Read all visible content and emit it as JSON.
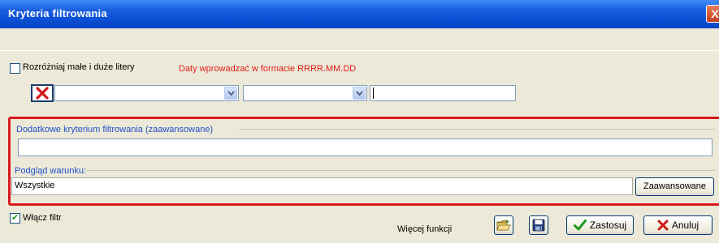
{
  "window": {
    "title": "Kryteria filtrowania",
    "close_glyph": "X"
  },
  "options": {
    "case_sensitive_label": "Rozróżniaj małe i duże litery",
    "case_sensitive_checked": false,
    "date_hint": "Daty wprowadzać w formacie RRRR.MM.DD"
  },
  "criteria_row": {
    "remove_icon": "red-x-icon",
    "field_select_value": "",
    "operator_select_value": "",
    "value_input": ""
  },
  "advanced": {
    "group_label": "Dodatkowe kryterium filtrowania (zaawansowane)",
    "value": ""
  },
  "preview": {
    "group_label": "Podgląd warunku:",
    "value": "Wszystkie",
    "advanced_button": "Zaawansowane"
  },
  "footer": {
    "enable_filter_label": "Włącz filtr",
    "enable_filter_checked": true,
    "more_functions_label": "Więcej funkcji",
    "open_icon": "open-folder-icon",
    "save_icon": "save-disk-icon",
    "apply_label": "Zastosuj",
    "cancel_label": "Anuluj"
  },
  "colors": {
    "accent_red": "#d8181f",
    "hint_red": "#e21b1b",
    "title_blue": "#0a4fd4",
    "label_blue": "#1f4fc9"
  }
}
